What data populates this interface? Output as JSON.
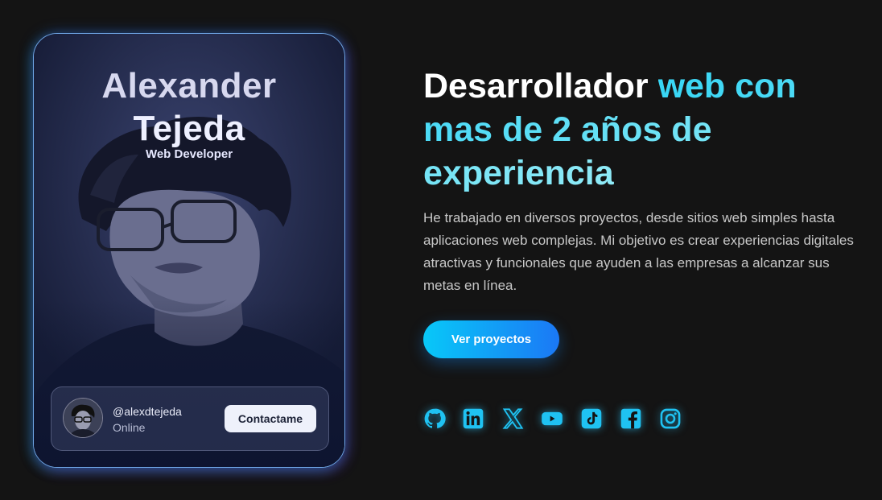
{
  "card": {
    "name_line1": "Alexander",
    "name_line2": "Tejeda",
    "role": "Web Developer",
    "handle": "@alexdtejeda",
    "status": "Online",
    "contact_label": "Contactame"
  },
  "hero": {
    "headline_part1": "Desarrollador ",
    "headline_part2": "web con mas de 2 años de experiencia",
    "description": "He trabajado en diversos proyectos, desde sitios web simples hasta aplicaciones web complejas. Mi objetivo es crear experiencias digitales atractivas y funcionales que ayuden a las empresas a alcanzar sus metas en línea.",
    "cta_label": "Ver proyectos"
  },
  "socials": [
    "github-icon",
    "linkedin-icon",
    "x-icon",
    "youtube-icon",
    "tiktok-icon",
    "facebook-icon",
    "instagram-icon"
  ],
  "colors": {
    "background": "#141414",
    "accent_cyan": "#38d6f5",
    "button_start": "#08c8f8",
    "button_end": "#1b78f5"
  }
}
